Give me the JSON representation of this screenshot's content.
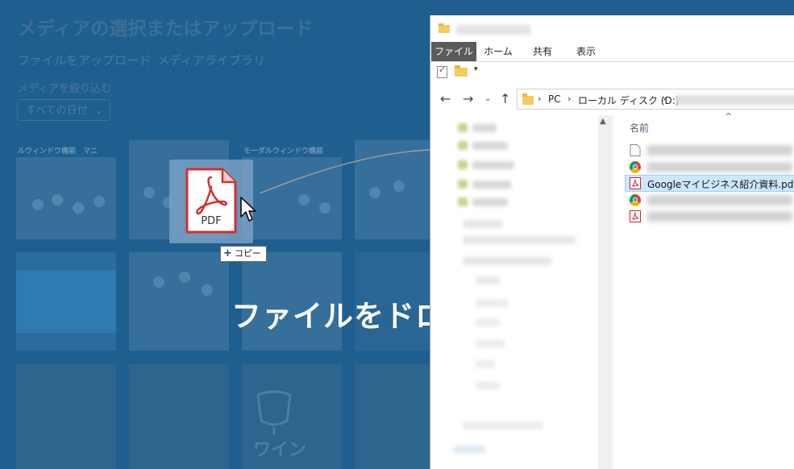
{
  "media_modal": {
    "title": "メディアの選択またはアップロード",
    "tabs": [
      "ファイルをアップロード",
      "メディアライブラリ"
    ],
    "filter_label": "メディアを絞り込む",
    "date_filter": "すべての日付",
    "thumb_captions": [
      "ルウィンドウ機能　マニ",
      "モーダルウィンドウ機能　"
    ],
    "thumb_text": "ワイン",
    "drop_overlay_text": "ファイルをドロ"
  },
  "drag": {
    "file_icon": "pdf-file-icon",
    "file_label": "PDF",
    "copy_tooltip": "コピー",
    "copy_plus": "+"
  },
  "explorer": {
    "ribbon_tabs": [
      "ファイル",
      "ホーム",
      "共有",
      "表示"
    ],
    "active_tab": "ファイル",
    "address": {
      "crumbs": [
        "PC",
        "ローカル ディスク (D:)"
      ]
    },
    "column_header": "名前",
    "files": [
      {
        "icon": "blank-file-icon",
        "name": ""
      },
      {
        "icon": "chrome-icon",
        "name": ""
      },
      {
        "icon": "pdf-icon",
        "name": "Googleマイビジネス紹介資料.pdf",
        "selected": true
      },
      {
        "icon": "chrome-icon",
        "name": ""
      },
      {
        "icon": "pdf-icon",
        "name": ""
      }
    ]
  },
  "colors": {
    "overlay_blue": "#1f5f8f",
    "selection": "#cce8ff",
    "pdf_red": "#d32f2f"
  }
}
